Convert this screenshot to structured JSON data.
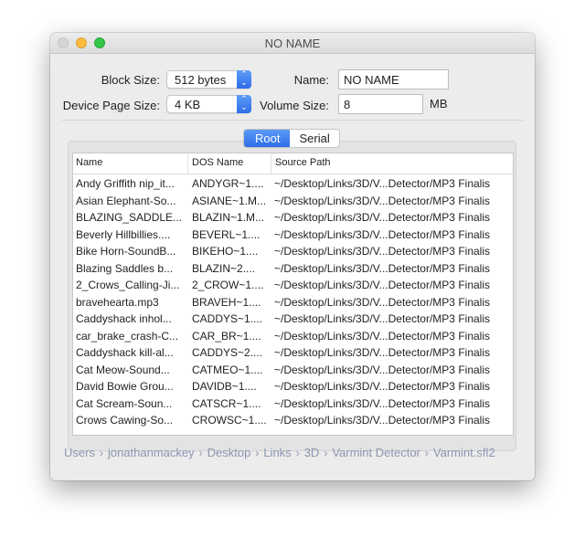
{
  "window": {
    "title": "NO NAME",
    "traffic_lights": [
      "close",
      "minimize",
      "zoom"
    ]
  },
  "form": {
    "block_size": {
      "label": "Block Size:",
      "value": "512 bytes"
    },
    "device_page_size": {
      "label": "Device Page Size:",
      "value": "4 KB"
    },
    "name": {
      "label": "Name:",
      "value": "NO NAME"
    },
    "volume_size": {
      "label": "Volume Size:",
      "value": "8",
      "unit": "MB"
    }
  },
  "tabs": [
    {
      "label": "Root",
      "active": true
    },
    {
      "label": "Serial",
      "active": false
    }
  ],
  "table": {
    "columns": [
      "Name",
      "DOS Name",
      "Source Path"
    ],
    "rows": [
      [
        "Andy Griffith nip_it...",
        "ANDYGR~1....",
        "~/Desktop/Links/3D/V...Detector/MP3 Finalis"
      ],
      [
        "Asian Elephant-So...",
        "ASIANE~1.M...",
        "~/Desktop/Links/3D/V...Detector/MP3 Finalis"
      ],
      [
        "BLAZING_SADDLE...",
        "BLAZIN~1.M...",
        "~/Desktop/Links/3D/V...Detector/MP3 Finalis"
      ],
      [
        "Beverly Hillbillies....",
        "BEVERL~1....",
        "~/Desktop/Links/3D/V...Detector/MP3 Finalis"
      ],
      [
        "Bike Horn-SoundB...",
        "BIKEHO~1....",
        "~/Desktop/Links/3D/V...Detector/MP3 Finalis"
      ],
      [
        "Blazing Saddles b...",
        "BLAZIN~2....",
        "~/Desktop/Links/3D/V...Detector/MP3 Finalis"
      ],
      [
        "2_Crows_Calling-Ji...",
        "2_CROW~1....",
        "~/Desktop/Links/3D/V...Detector/MP3 Finalis"
      ],
      [
        "bravehearta.mp3",
        "BRAVEH~1....",
        "~/Desktop/Links/3D/V...Detector/MP3 Finalis"
      ],
      [
        "Caddyshack inhol...",
        "CADDYS~1....",
        "~/Desktop/Links/3D/V...Detector/MP3 Finalis"
      ],
      [
        "car_brake_crash-C...",
        "CAR_BR~1....",
        "~/Desktop/Links/3D/V...Detector/MP3 Finalis"
      ],
      [
        "Caddyshack kill-al...",
        "CADDYS~2....",
        "~/Desktop/Links/3D/V...Detector/MP3 Finalis"
      ],
      [
        "Cat Meow-Sound...",
        "CATMEO~1....",
        "~/Desktop/Links/3D/V...Detector/MP3 Finalis"
      ],
      [
        "David Bowie Grou...",
        "DAVIDB~1....",
        "~/Desktop/Links/3D/V...Detector/MP3 Finalis"
      ],
      [
        "Cat Scream-Soun...",
        "CATSCR~1....",
        "~/Desktop/Links/3D/V...Detector/MP3 Finalis"
      ],
      [
        "Crows Cawing-So...",
        "CROWSC~1....",
        "~/Desktop/Links/3D/V...Detector/MP3 Finalis"
      ]
    ]
  },
  "breadcrumb": [
    "Users",
    "jonathanmackey",
    "Desktop",
    "Links",
    "3D",
    "Varmint Detector",
    "Varmint.sfl2"
  ],
  "colors": {
    "accent": "#2f6ce9",
    "close": "#d5d5d5",
    "minimize": "#fdbc40",
    "zoom": "#34c84a",
    "breadcrumb_text": "#8a96b0"
  }
}
